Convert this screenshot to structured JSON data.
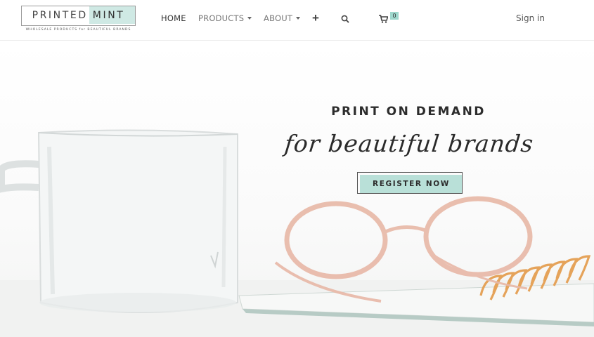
{
  "header": {
    "logo": {
      "word1": "PRINTED",
      "word2": "MINT",
      "tagline": "WHOLESALE PRODUCTS for BEAUTIFUL BRANDS"
    },
    "nav": {
      "home": "HOME",
      "products": "PRODUCTS",
      "about": "ABOUT",
      "add_icon": "plus-icon",
      "search_icon": "search-icon",
      "cart_icon": "cart-icon",
      "cart_count": "0"
    },
    "signin": "Sign in"
  },
  "hero": {
    "title": "PRINT ON DEMAND",
    "script": "for beautiful brands",
    "cta": "REGISTER NOW"
  },
  "colors": {
    "mint": "#b9e0d8",
    "mint_light": "#cfe9e4",
    "badge": "#9ed8cd",
    "glasses": "#e8b9a8",
    "spiral": "#e5a35a"
  }
}
